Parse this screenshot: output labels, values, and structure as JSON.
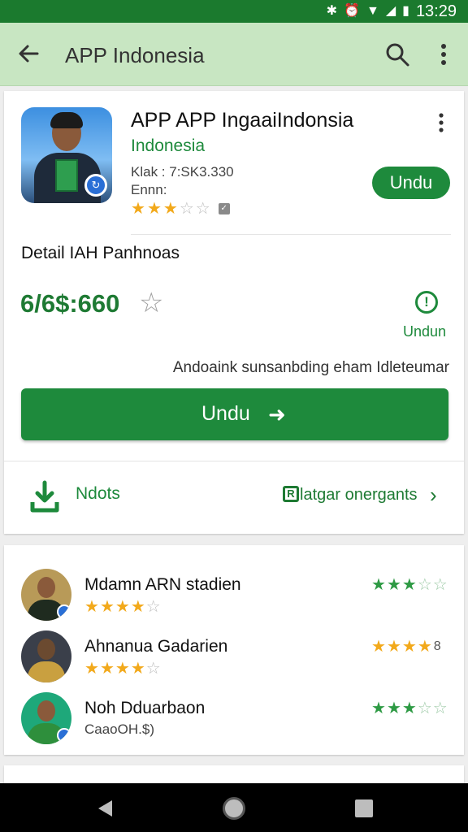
{
  "status_bar": {
    "time": "13:29",
    "icons": [
      "bluetooth-icon",
      "alarm-icon",
      "wifi-icon",
      "signal-icon",
      "battery-icon"
    ],
    "background": "#1b7a2e"
  },
  "app_bar": {
    "title": "APP Indonesia",
    "background": "#c8e6c2"
  },
  "app": {
    "name": "APP APP IngaaiIndonsia",
    "subtitle": "Indonesia",
    "meta1": "Klak : 7:SK3.330",
    "meta2": "Ennn:",
    "rating": 3.5,
    "rating_max": 5,
    "install_small_label": "Undu",
    "accent": "#1e8a3c"
  },
  "details": {
    "section_title": "Detail IAH Panhnoas",
    "price": "6/6$:660",
    "alert_label": "Undun",
    "description": "Andoaink sunsanbding eham Idleteumar",
    "install_big_label": "Undu",
    "downloads_label": "Ndots",
    "related_label": "latgar onergants"
  },
  "reviews": [
    {
      "name": "Mdamn ARN stadien",
      "stars": 4,
      "stars_max": 5,
      "right_stars": 3,
      "right_text": ""
    },
    {
      "name": "Ahnanua Gadarien",
      "stars": 4,
      "stars_max": 5,
      "right_stars": 4,
      "right_text": "8"
    },
    {
      "name": "Noh Dduarbaon",
      "sub": "CaaoOH.$)",
      "right_stars": 3,
      "right_text": ""
    }
  ]
}
